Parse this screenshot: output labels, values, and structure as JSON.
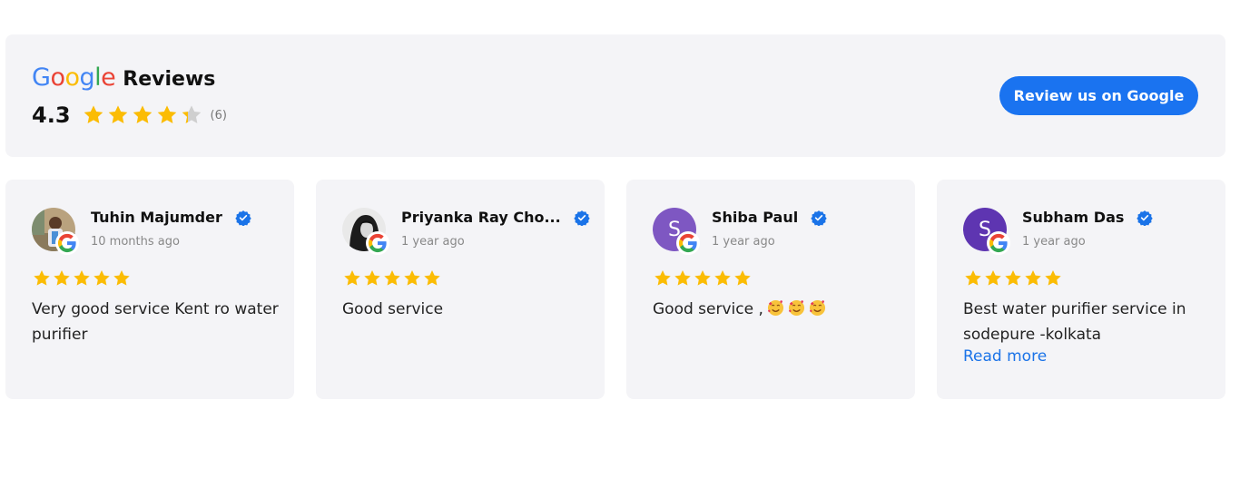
{
  "header": {
    "brand_google": [
      "G",
      "o",
      "o",
      "g",
      "l",
      "e"
    ],
    "brand_reviews": "Reviews",
    "rating": "4.3",
    "rating_value": 4.3,
    "rating_max": 5,
    "review_count": "(6)",
    "cta_label": "Review us on Google"
  },
  "colors": {
    "accent": "#1a73f0",
    "star": "#fbbc04",
    "star_empty": "#cfcfcf",
    "card_bg": "#f4f4f7",
    "google_blue": "#4285f4",
    "google_red": "#ea4335",
    "google_yellow": "#fbbc05",
    "google_green": "#34a853"
  },
  "reviews": [
    {
      "name": "Tuhin Majumder",
      "time": "10 months ago",
      "stars": 5,
      "text": "Very good service Kent ro water purifier",
      "avatar": "photo",
      "read_more": ""
    },
    {
      "name": "Priyanka Ray Cho...",
      "time": "1 year ago",
      "stars": 5,
      "text": "Good service",
      "avatar": "photo",
      "read_more": ""
    },
    {
      "name": "Shiba Paul",
      "time": "1 year ago",
      "stars": 5,
      "text": "Good service ,",
      "avatar": "S",
      "avatar_color": "#7e57c2",
      "emoji": "smiling-face-with-hearts-icon",
      "read_more": ""
    },
    {
      "name": "Subham Das",
      "time": "1 year ago",
      "stars": 5,
      "text": "Best water purifier service in sodepure -kolkata",
      "avatar": "S",
      "avatar_color": "#5e35b1",
      "read_more": "Read more"
    }
  ]
}
